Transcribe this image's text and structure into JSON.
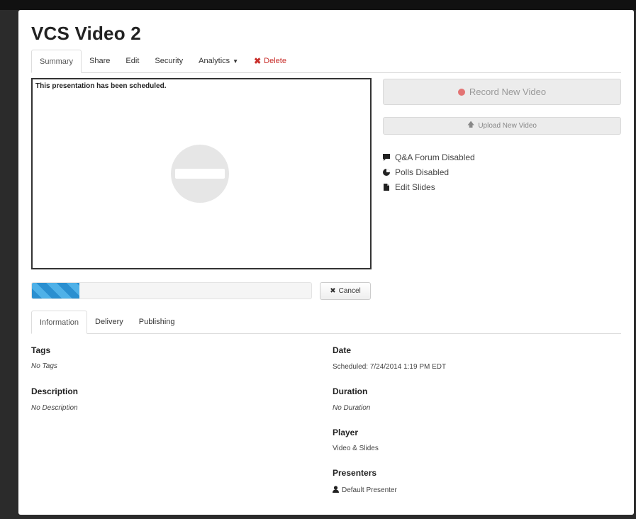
{
  "title": "VCS Video 2",
  "tabs": [
    {
      "label": "Summary"
    },
    {
      "label": "Share"
    },
    {
      "label": "Edit"
    },
    {
      "label": "Security"
    },
    {
      "label": "Analytics"
    },
    {
      "label": "Delete"
    }
  ],
  "player": {
    "message": "This presentation has been scheduled."
  },
  "progress": {
    "fraction": 0.17
  },
  "cancel_label": "Cancel",
  "actions": {
    "record_label": "Record New Video",
    "upload_label": "Upload New Video"
  },
  "links": [
    {
      "label": "Q&A Forum Disabled",
      "icon": "comment-icon"
    },
    {
      "label": "Polls Disabled",
      "icon": "pie-chart-icon"
    },
    {
      "label": "Edit Slides",
      "icon": "file-icon"
    }
  ],
  "info_tabs": [
    {
      "label": "Information"
    },
    {
      "label": "Delivery"
    },
    {
      "label": "Publishing"
    }
  ],
  "info": {
    "tags_label": "Tags",
    "tags_value": "No Tags",
    "description_label": "Description",
    "description_value": "No Description",
    "date_label": "Date",
    "date_value": "Scheduled: 7/24/2014 1:19 PM EDT",
    "duration_label": "Duration",
    "duration_value": "No Duration",
    "player_label": "Player",
    "player_value": "Video & Slides",
    "presenters_label": "Presenters",
    "presenters_value": "Default Presenter"
  },
  "colors": {
    "delete": "#c9302c",
    "record_dot": "#e37474",
    "progress": "#2a8fd0"
  }
}
